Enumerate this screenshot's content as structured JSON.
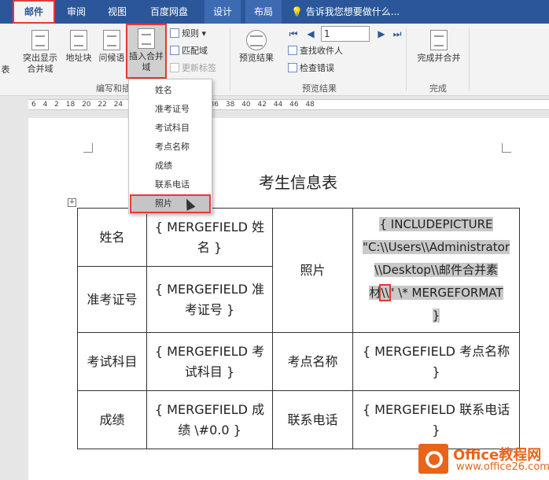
{
  "tabs": [
    "邮件",
    "审阅",
    "视图",
    "百度网盘",
    "设计",
    "布局"
  ],
  "tell_me": "告诉我您想要做什么...",
  "ribbon": {
    "cut_left_label": "表",
    "highlight_fields": "突出显示合并域",
    "address_block": "地址块",
    "greeting_line": "问候语",
    "insert_merge_field": "插入合并域",
    "rules": "规则",
    "match_fields": "匹配域",
    "update_labels": "更新标签",
    "preview_results": "预览结果",
    "record_number": "1",
    "find_recipient": "查找收件人",
    "check_errors": "检查错误",
    "finish_merge": "完成并合并",
    "group_write_insert": "编写和插",
    "group_preview": "预览结果",
    "group_finish": "完成"
  },
  "ruler_text": "6 4 2 18 20 22 24 26 28 30 32 34 36 38 40 42 44 46 48",
  "merge_menu": {
    "items": [
      "姓名",
      "准考证号",
      "考试科目",
      "考点名称",
      "成绩",
      "联系电话",
      "照片"
    ],
    "selected": "照片"
  },
  "document": {
    "title": "考生信息表",
    "rows": [
      {
        "label": "姓名",
        "field": "{ MERGEFIELD 姓名 }"
      },
      {
        "label": "准考证号",
        "field": "{ MERGEFIELD 准考证号 }"
      },
      {
        "label": "考试科目",
        "field": "{ MERGEFIELD 考试科目 }",
        "label2": "考点名称",
        "field2": "{ MERGEFIELD 考点名称 }"
      },
      {
        "label": "成绩",
        "field": "{ MERGEFIELD 成绩 \\#0.0 }",
        "label2": "联系电话",
        "field2": "{ MERGEFIELD 联系电话 }"
      }
    ],
    "photo_label": "照片",
    "photo_field": {
      "line1": "{ INCLUDEPICTURE",
      "line2": "\"C:\\\\Users\\\\Administrator",
      "line3": "\\\\Desktop\\\\邮件合并素",
      "line4_pre": "材",
      "line4_boxed": "\\\\",
      "line4_post": "\"   \\* MERGEFORMAT",
      "line5": "}"
    }
  },
  "watermark": {
    "name": "Office教程网",
    "url": "www.office26.com"
  },
  "colors": {
    "tab_bar": "#2b579a",
    "highlight_box": "#e53935",
    "field_shading": "#c9c9c9",
    "logo": "#e8641b"
  }
}
